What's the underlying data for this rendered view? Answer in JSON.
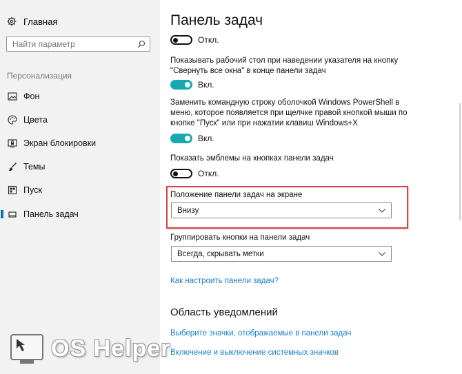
{
  "sidebar": {
    "home_label": "Главная",
    "search_placeholder": "Найти параметр",
    "section_label": "Персонализация",
    "items": [
      {
        "label": "Фон",
        "icon": "image-icon"
      },
      {
        "label": "Цвета",
        "icon": "palette-icon"
      },
      {
        "label": "Экран блокировки",
        "icon": "lock-screen-icon"
      },
      {
        "label": "Темы",
        "icon": "brush-icon"
      },
      {
        "label": "Пуск",
        "icon": "start-icon"
      },
      {
        "label": "Панель задач",
        "icon": "taskbar-icon",
        "active": true
      }
    ]
  },
  "main": {
    "title": "Панель задач",
    "toggle1": {
      "state": "off",
      "label": "Откл."
    },
    "desc_peek": "Показывать рабочий стол при наведении указателя на кнопку \"Свернуть все окна\" в конце панели задач",
    "toggle_peek": {
      "state": "on",
      "label": "Вкл."
    },
    "desc_powershell": "Заменить командную строку оболочкой Windows PowerShell в меню, которое появляется при щелчке правой кнопкой мыши по кнопке \"Пуск\" или при нажатии клавиш Windows+X",
    "toggle_powershell": {
      "state": "on",
      "label": "Вкл."
    },
    "desc_badges": "Показать эмблемы на кнопках панели задач",
    "toggle_badges": {
      "state": "off",
      "label": "Откл."
    },
    "position_label": "Положение панели задач на экране",
    "position_value": "Внизу",
    "group_label": "Группировать кнопки на панели задач",
    "group_value": "Всегда, скрывать метки",
    "help_link": "Как настроить панели задач?",
    "notifications_title": "Область уведомлений",
    "link_icons": "Выберите значки, отображаемые в панели задач",
    "link_system_icons": "Включение и выключение системных значков"
  },
  "watermark": {
    "text": "OS Helper"
  },
  "colors": {
    "accent": "#0a76c5",
    "toggle_on": "#16aab0",
    "link": "#1a7fc7",
    "highlight": "#d94040",
    "sidebar_bg": "#f2f2f2"
  }
}
